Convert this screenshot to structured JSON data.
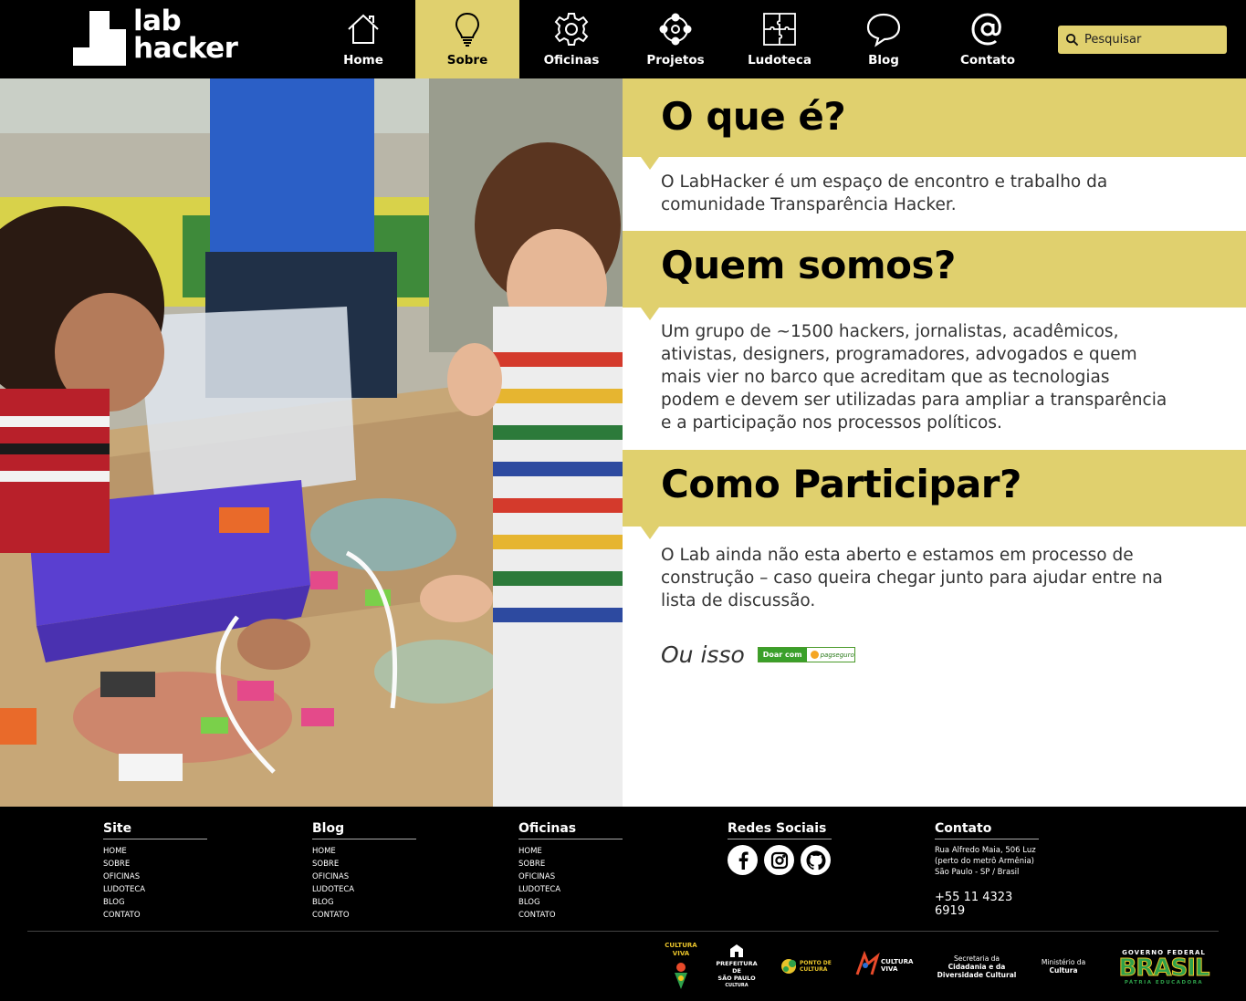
{
  "header": {
    "logo_line1": "lab",
    "logo_line2": "hacker",
    "nav": [
      {
        "label": "Home",
        "icon": "house-icon"
      },
      {
        "label": "Sobre",
        "icon": "lightbulb-icon",
        "active": true
      },
      {
        "label": "Oficinas",
        "icon": "gear-icon"
      },
      {
        "label": "Projetos",
        "icon": "network-icon"
      },
      {
        "label": "Ludoteca",
        "icon": "puzzle-icon"
      },
      {
        "label": "Blog",
        "icon": "speech-bubble-icon"
      },
      {
        "label": "Contato",
        "icon": "at-sign-icon"
      }
    ],
    "search_placeholder": "Pesquisar"
  },
  "colors": {
    "accent": "#e0d06e",
    "background": "#000000",
    "text": "#333333"
  },
  "sections": [
    {
      "title": "O que é?",
      "text": "O LabHacker é um espaço de encontro e trabalho da comunidade Transparência Hacker."
    },
    {
      "title": "Quem somos?",
      "text": "Um grupo de ~1500 hackers,  jornalistas, acadêmicos, ativistas, designers, programadores, advogados e quem mais vier no barco que acreditam que as tecnologias podem e devem ser utilizadas para ampliar a transparência e a participação nos processos políticos."
    },
    {
      "title": "Como Participar?",
      "text": "O Lab ainda não esta aberto e estamos em processo de construção – caso queira chegar junto para ajudar entre na lista de discussão."
    }
  ],
  "donate": {
    "lead": "Ou isso",
    "button_left": "Doar com",
    "button_brand": "pagseguro"
  },
  "footer": {
    "columns": [
      {
        "title": "Site",
        "links": [
          "HOME",
          "SOBRE",
          "OFICINAS",
          "LUDOTECA",
          "BLOG",
          "CONTATO"
        ]
      },
      {
        "title": "Blog",
        "links": [
          "HOME",
          "SOBRE",
          "OFICINAS",
          "LUDOTECA",
          "BLOG",
          "CONTATO"
        ]
      },
      {
        "title": "Oficinas",
        "links": [
          "HOME",
          "SOBRE",
          "OFICINAS",
          "LUDOTECA",
          "BLOG",
          "CONTATO"
        ]
      }
    ],
    "social_title": "Redes Sociais",
    "social": [
      "facebook-icon",
      "instagram-icon",
      "github-icon"
    ],
    "contact_title": "Contato",
    "address_1": "Rua Alfredo Maia, 506 Luz",
    "address_2": "(perto do metrô Armênia)",
    "address_3": "São Paulo - SP / Brasil",
    "phone": "+55 11 4323 6919",
    "partners": {
      "cultura_viva_sp": "CULTURA VIVA",
      "prefeitura_1": "PREFEITURA DE",
      "prefeitura_2": "SÃO PAULO",
      "prefeitura_3": "CULTURA",
      "ponto_cultura": "PONTO DE CULTURA",
      "cultura_viva": "CULTURA VIVA",
      "secretaria_1": "Secretaria da",
      "secretaria_2": "Cidadania e da",
      "secretaria_3": "Diversidade Cultural",
      "ministerio_1": "Ministério da",
      "ministerio_2": "Cultura",
      "gov_1": "GOVERNO FEDERAL",
      "gov_2": "BRASIL",
      "gov_3": "PÁTRIA EDUCADORA"
    }
  }
}
